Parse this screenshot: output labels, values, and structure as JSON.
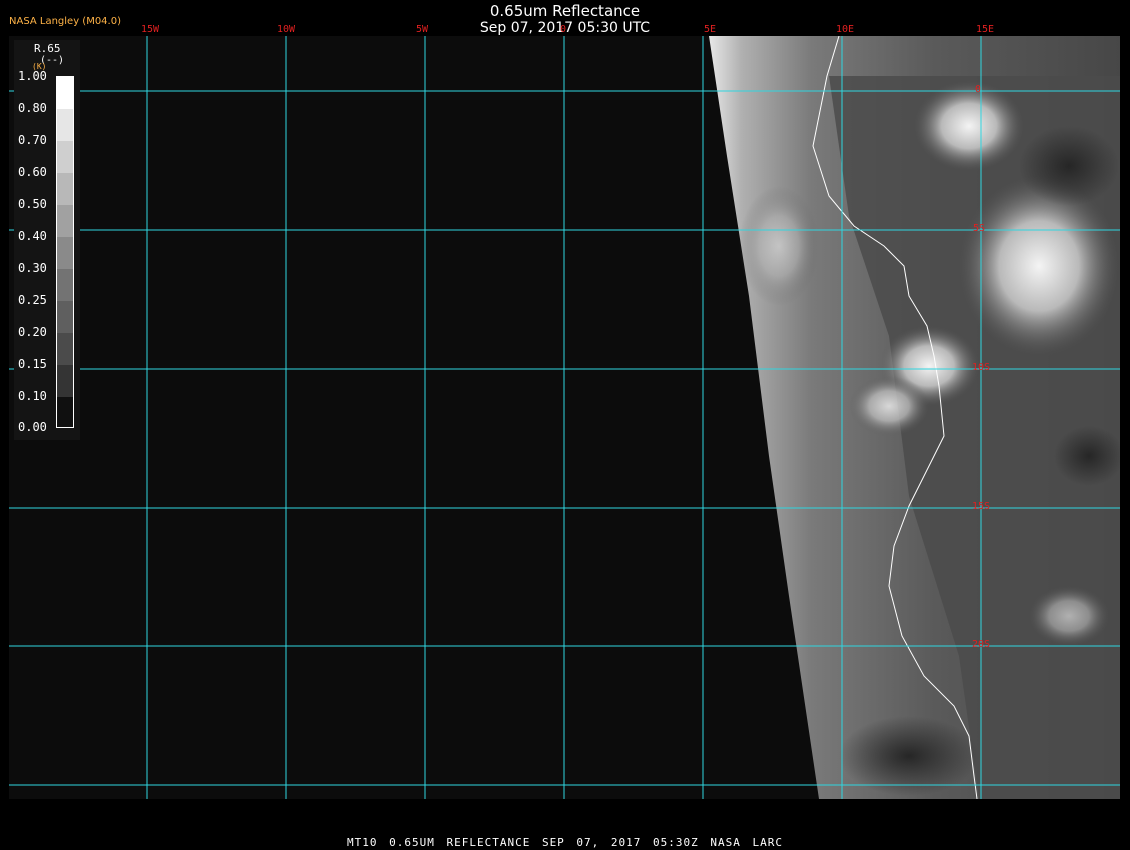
{
  "header": {
    "title": "0.65um Reflectance",
    "timestamp": "Sep 07, 2017 05:30 UTC",
    "brand": "NASA Langley (M04.0)"
  },
  "map": {
    "longitude_labels": [
      "15W",
      "10W",
      "5W",
      "0",
      "5E",
      "10E",
      "15E"
    ],
    "latitude_labels": [
      "0",
      "5S",
      "10S",
      "15S",
      "20S"
    ],
    "colors": {
      "background": "#0c0c0c",
      "grid": "#2fd6e0",
      "grid_label": "#e02020",
      "coastline": "#ffffff"
    }
  },
  "colorbar": {
    "variable": "R.65",
    "units": "(--)",
    "k_label": "(K)",
    "ticks": [
      "1.00",
      "0.80",
      "0.70",
      "0.60",
      "0.50",
      "0.40",
      "0.30",
      "0.25",
      "0.20",
      "0.15",
      "0.10",
      "0.00"
    ]
  },
  "footer": {
    "text": "MT10  0.65UM REFLECTANCE   SEP 07, 2017 05:30Z   NASA LARC"
  }
}
